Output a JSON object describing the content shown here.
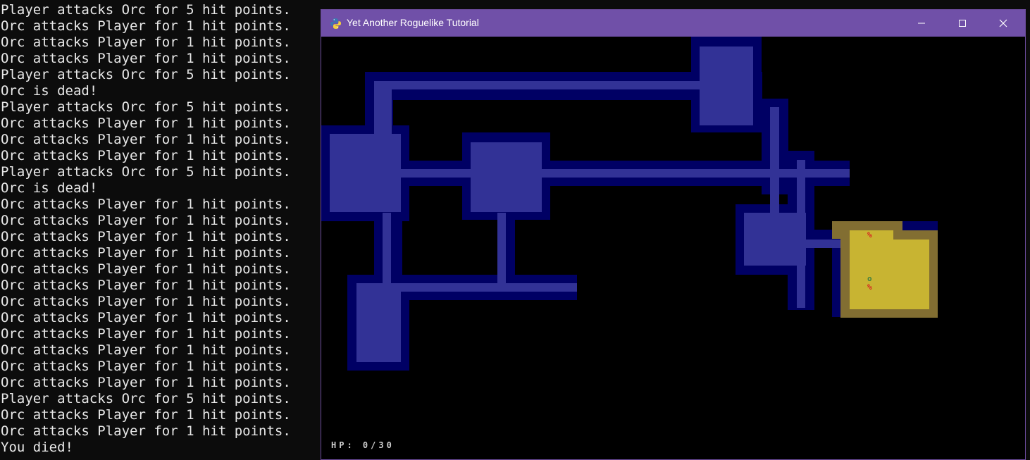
{
  "terminal": {
    "lines": [
      "Player attacks Orc for 5 hit points.",
      "Orc attacks Player for 1 hit points.",
      "Orc attacks Player for 1 hit points.",
      "Orc attacks Player for 1 hit points.",
      "Player attacks Orc for 5 hit points.",
      "Orc is dead!",
      "Player attacks Orc for 5 hit points.",
      "Orc attacks Player for 1 hit points.",
      "Orc attacks Player for 1 hit points.",
      "Orc attacks Player for 1 hit points.",
      "Player attacks Orc for 5 hit points.",
      "Orc is dead!",
      "Orc attacks Player for 1 hit points.",
      "Orc attacks Player for 1 hit points.",
      "Orc attacks Player for 1 hit points.",
      "Orc attacks Player for 1 hit points.",
      "Orc attacks Player for 1 hit points.",
      "Orc attacks Player for 1 hit points.",
      "Orc attacks Player for 1 hit points.",
      "Orc attacks Player for 1 hit points.",
      "Orc attacks Player for 1 hit points.",
      "Orc attacks Player for 1 hit points.",
      "Orc attacks Player for 1 hit points.",
      "Orc attacks Player for 1 hit points.",
      "Player attacks Orc for 5 hit points.",
      "Orc attacks Player for 1 hit points.",
      "Orc attacks Player for 1 hit points.",
      "You died!"
    ]
  },
  "window": {
    "title": "Yet Another Roguelike Tutorial",
    "icons": {
      "app": "python-icon",
      "minimize": "minimize-icon",
      "maximize": "maximize-icon",
      "close": "close-icon"
    }
  },
  "game": {
    "hp_text": "HP: 0/30",
    "entities": {
      "corpse_symbol": "%",
      "corpse_color": "#d82020",
      "orc_symbol": "o",
      "orc_color": "#3f7f3f"
    },
    "colors": {
      "wall_dark": "#000064",
      "floor_dark": "#323296",
      "wall_light": "#826e32",
      "floor_light": "#c8b432",
      "background": "#000000",
      "titlebar": "#7050a8"
    }
  }
}
